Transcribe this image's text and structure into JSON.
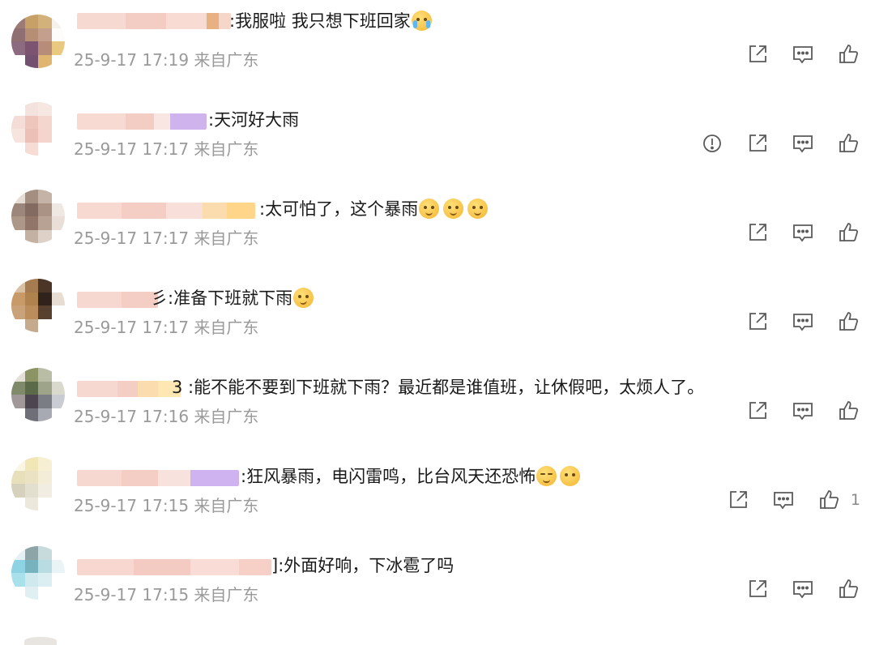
{
  "comments": [
    {
      "text": ":我服啦 我只想下班回家",
      "emojis": [
        "crying"
      ],
      "meta": "25-9-17 17:19 来自广东",
      "report": false,
      "likes": ""
    },
    {
      "text": ":天河好大雨",
      "emojis": [],
      "meta": "25-9-17 17:17 来自广东",
      "report": true,
      "likes": ""
    },
    {
      "text": ":太可怕了，这个暴雨",
      "emojis": [
        "melting",
        "melting",
        "melting"
      ],
      "meta": "25-9-17 17:17 来自广东",
      "report": false,
      "likes": ""
    },
    {
      "text": "彡:准备下班就下雨",
      "emojis": [
        "thinking"
      ],
      "meta": "25-9-17 17:17 来自广东",
      "report": false,
      "likes": ""
    },
    {
      "text": "3 :能不能不要到下班就下雨？最近都是谁值班，让休假吧，太烦人了。",
      "emojis": [],
      "meta": "25-9-17 17:16 来自广东",
      "report": false,
      "likes": ""
    },
    {
      "text": ":狂风暴雨，电闪雷鸣，比台风天还恐怖",
      "emojis": [
        "smirk",
        "hand-over-mouth"
      ],
      "meta": "25-9-17 17:15 来自广东",
      "report": false,
      "likes": "1"
    },
    {
      "text": "]:外面好响，下冰雹了吗",
      "emojis": [],
      "meta": "25-9-17 17:15 来自广东",
      "report": false,
      "likes": ""
    }
  ],
  "icons": {
    "share": "share-icon",
    "comment": "comment-icon",
    "like": "like-icon",
    "report": "report-icon"
  },
  "colors": {
    "text": "#1a1a1a",
    "meta": "#9a9a9a",
    "icon": "#5a5a5a"
  }
}
